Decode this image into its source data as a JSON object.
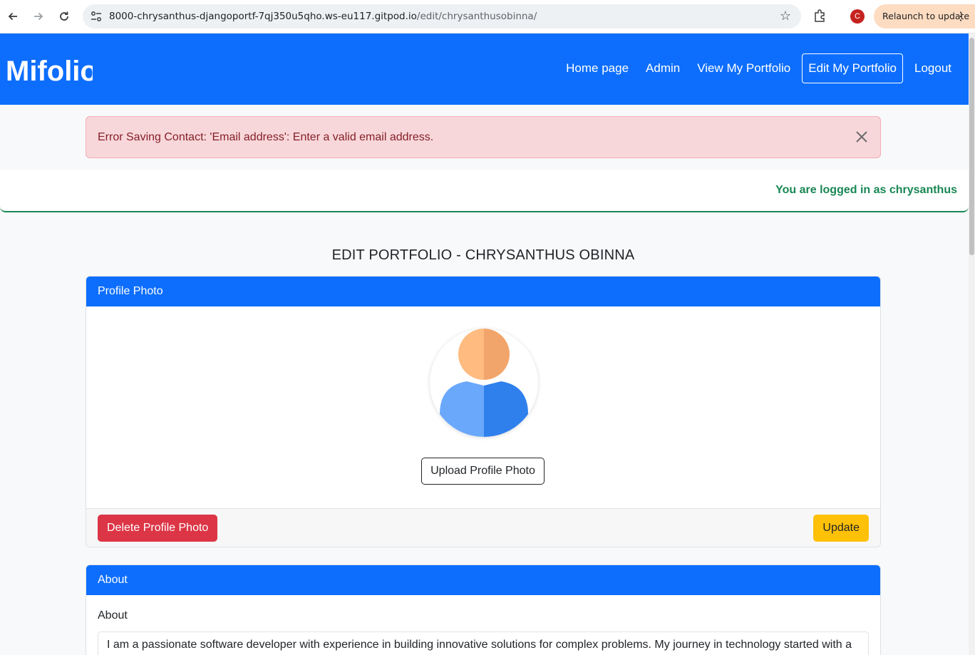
{
  "browser": {
    "url_host": "8000-chrysanthus-djangoportf-7qj350u5qho.ws-eu117.gitpod.io",
    "url_path": "/edit/chrysanthusobinna/",
    "profile_initial": "C",
    "relaunch_label": "Relaunch to update"
  },
  "navbar": {
    "brand": "Mifolio",
    "links": [
      "Home page",
      "Admin",
      "View My Portfolio",
      "Edit My Portfolio",
      "Logout"
    ],
    "active": "Edit My Portfolio",
    "color": "#0d6efd"
  },
  "alert": {
    "message": "Error Saving Contact: 'Email address': Enter a valid email address."
  },
  "user_status": {
    "text": "You are logged in as chrysanthus"
  },
  "page": {
    "title": "EDIT PORTFOLIO - CHRYSANTHUS OBINNA"
  },
  "profile_photo": {
    "header": "Profile Photo",
    "upload_label": "Upload Profile Photo",
    "delete_label": "Delete Profile Photo",
    "update_label": "Update"
  },
  "about": {
    "header": "About",
    "field_label": "About",
    "text": "I am a passionate software developer with experience in building innovative solutions for complex problems. My journey in technology started with a"
  }
}
